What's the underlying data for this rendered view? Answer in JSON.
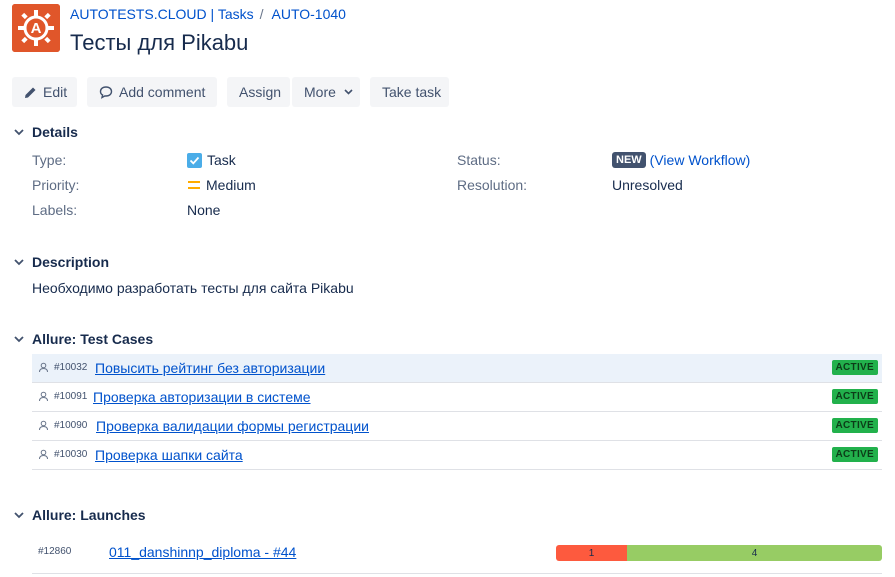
{
  "header": {
    "project": "AUTOTESTS.CLOUD | Tasks",
    "separator": "/",
    "issue_key": "AUTO-1040",
    "title": "Тесты для Pikabu"
  },
  "toolbar": {
    "edit": "Edit",
    "add_comment": "Add comment",
    "assign": "Assign",
    "more": "More",
    "take_task": "Take task"
  },
  "details": {
    "heading": "Details",
    "type_label": "Type:",
    "type_value": "Task",
    "priority_label": "Priority:",
    "priority_value": "Medium",
    "labels_label": "Labels:",
    "labels_value": "None",
    "status_label": "Status:",
    "status_value": "NEW",
    "workflow_link": "(View Workflow)",
    "resolution_label": "Resolution:",
    "resolution_value": "Unresolved"
  },
  "description": {
    "heading": "Description",
    "text": "Необходимо разработать тесты для сайта Pikabu"
  },
  "test_cases": {
    "heading": "Allure: Test Cases",
    "items": [
      {
        "id": "#10032",
        "name": "Повысить рейтинг без авторизации",
        "status": "ACTIVE"
      },
      {
        "id": "#10091",
        "name": "Проверка авторизации в системе",
        "status": "ACTIVE"
      },
      {
        "id": "#10090",
        "name": "Проверка валидации формы регистрации",
        "status": "ACTIVE"
      },
      {
        "id": "#10030",
        "name": "Проверка шапки сайта",
        "status": "ACTIVE"
      }
    ]
  },
  "launches": {
    "heading": "Allure: Launches",
    "items": [
      {
        "id": "#12860",
        "name": "011_danshinnp_diploma - #44",
        "failed": "1",
        "passed": "4"
      }
    ]
  },
  "colors": {
    "brand": "#e0562a",
    "link": "#0052cc",
    "active_badge": "#22b14c",
    "failed": "#fd5a3e",
    "passed": "#97cc64"
  }
}
